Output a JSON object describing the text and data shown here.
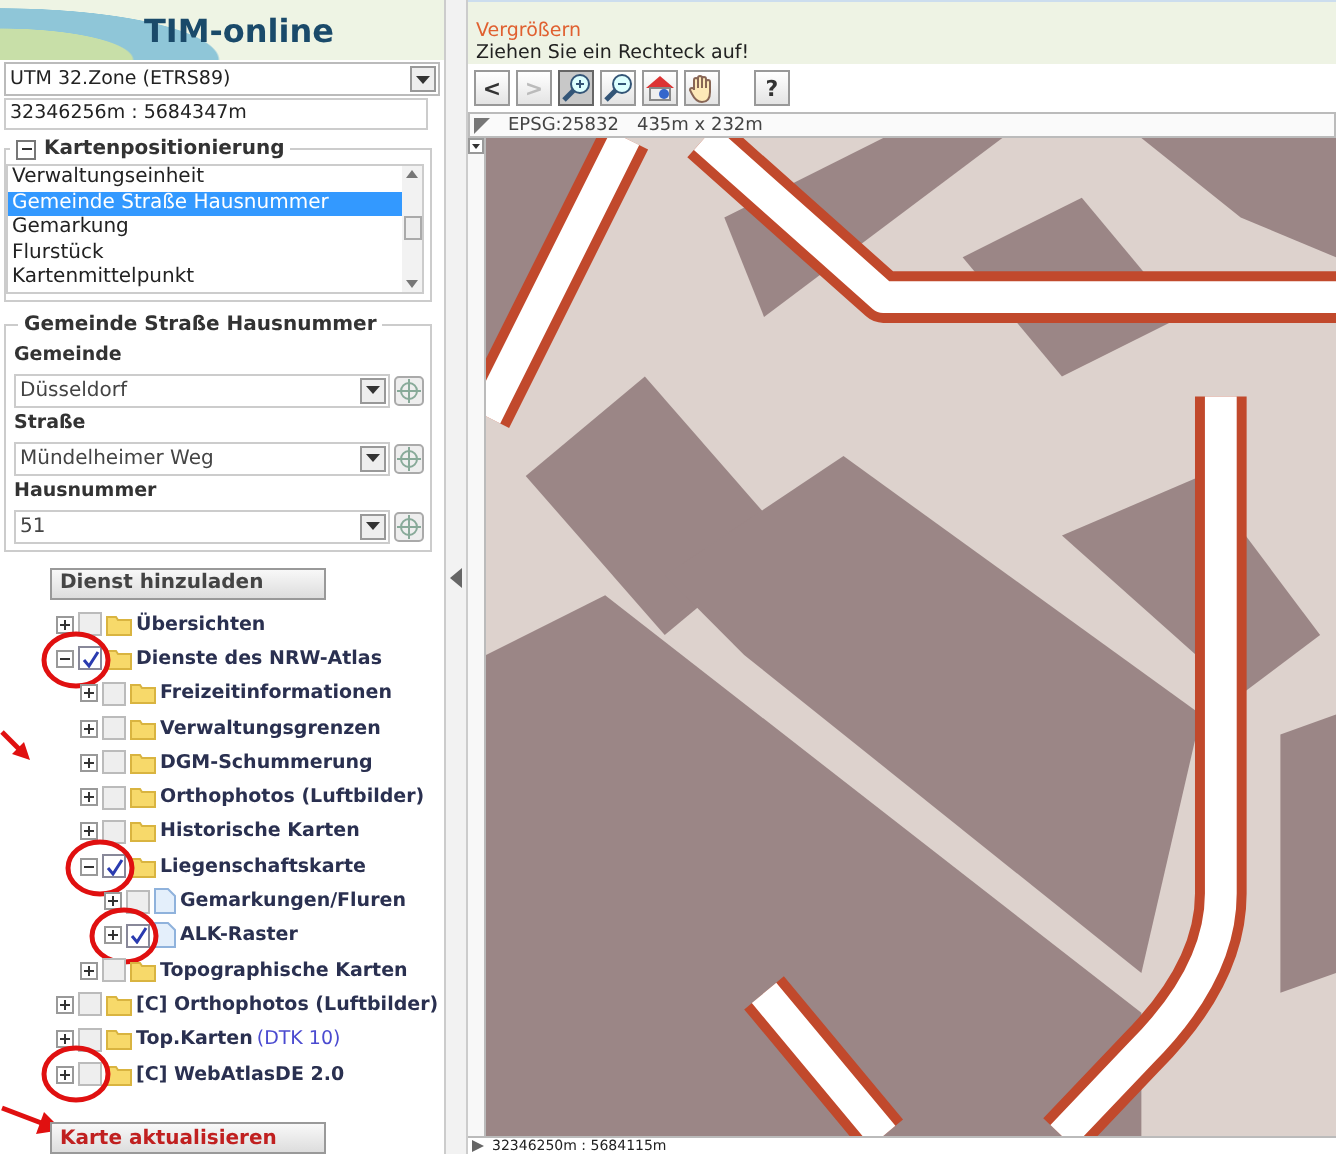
{
  "app": {
    "title": "TIM-online"
  },
  "crs_select": {
    "value": "UTM 32.Zone (ETRS89)"
  },
  "coordinates": {
    "value": "32346256m : 5684347m"
  },
  "positioning": {
    "title": "Kartenpositionierung",
    "expanded": true,
    "items": [
      {
        "label": "Verwaltungseinheit",
        "selected": false
      },
      {
        "label": "Gemeinde Straße Hausnummer",
        "selected": true
      },
      {
        "label": "Gemarkung",
        "selected": false
      },
      {
        "label": "Flurstück",
        "selected": false
      },
      {
        "label": "Kartenmittelpunkt",
        "selected": false
      }
    ]
  },
  "address": {
    "title": "Gemeinde Straße Hausnummer",
    "fields": [
      {
        "label": "Gemeinde",
        "value": "Düsseldorf"
      },
      {
        "label": "Straße",
        "value": "Mündelheimer Weg"
      },
      {
        "label": "Hausnummer",
        "value": "51"
      }
    ]
  },
  "add_service_button": "Dienst hinzuladen",
  "layers": [
    {
      "label": "Übersichten",
      "kind": "folder",
      "checked": false,
      "expanded": false,
      "marked": false
    },
    {
      "label": "Dienste des NRW-Atlas",
      "kind": "folder",
      "checked": true,
      "expanded": true,
      "marked": true,
      "children": [
        {
          "label": "Freizeitinformationen",
          "kind": "folder",
          "checked": false,
          "expanded": false,
          "marked": false
        },
        {
          "label": "Verwaltungsgrenzen",
          "kind": "folder",
          "checked": false,
          "expanded": false,
          "marked": false
        },
        {
          "label": "DGM-Schummerung",
          "kind": "folder",
          "checked": false,
          "expanded": false,
          "marked": false
        },
        {
          "label": "Orthophotos (Luftbilder)",
          "kind": "folder",
          "checked": false,
          "expanded": false,
          "marked": false
        },
        {
          "label": "Historische Karten",
          "kind": "folder",
          "checked": false,
          "expanded": false,
          "marked": false
        },
        {
          "label": "Liegenschaftskarte",
          "kind": "folder",
          "checked": true,
          "expanded": true,
          "marked": true,
          "children": [
            {
              "label": "Gemarkungen/Fluren",
              "kind": "layer",
              "checked": false,
              "expanded": false,
              "marked": false
            },
            {
              "label": "ALK-Raster",
              "kind": "layer",
              "checked": true,
              "expanded": false,
              "marked": true
            }
          ]
        },
        {
          "label": "Topographische Karten",
          "kind": "folder",
          "checked": false,
          "expanded": false,
          "marked": false
        }
      ]
    },
    {
      "label": "[C] Orthophotos (Luftbilder)",
      "kind": "folder",
      "checked": false,
      "expanded": false,
      "marked": false
    },
    {
      "label": "Top.Karten",
      "note": "(DTK 10)",
      "kind": "folder",
      "checked": false,
      "expanded": false,
      "marked": false
    },
    {
      "label": "[C] WebAtlasDE 2.0",
      "kind": "folder",
      "checked": false,
      "expanded": false,
      "marked": true
    }
  ],
  "update_button": "Karte aktualisieren",
  "hint": {
    "tool": "Vergrößern",
    "message": "Ziehen Sie ein Rechteck auf!"
  },
  "toolbar": [
    {
      "kind": "text",
      "label": "<",
      "disabled": false,
      "selected": false
    },
    {
      "kind": "text",
      "label": ">",
      "disabled": true,
      "selected": false
    },
    {
      "kind": "zoom-in",
      "selected": true
    },
    {
      "kind": "zoom-out",
      "selected": false
    },
    {
      "kind": "home",
      "selected": false
    },
    {
      "kind": "hand",
      "selected": false
    },
    {
      "kind": "help",
      "label": "?",
      "selected": false
    }
  ],
  "map": {
    "crs": "EPSG:25832",
    "extent": "435m x 232m",
    "cursor_coordinates": "32346250m : 5684115m"
  }
}
